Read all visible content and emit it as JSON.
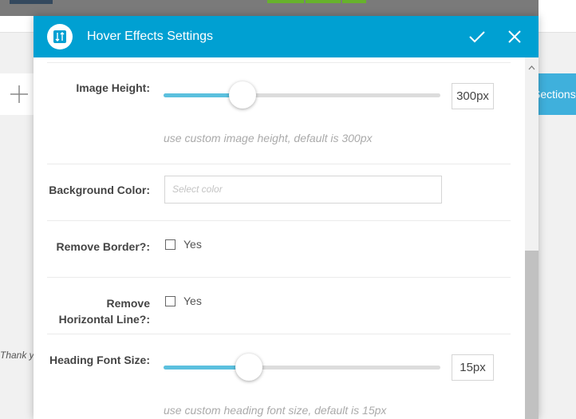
{
  "background": {
    "sections_label": "Sections",
    "thank_text": "Thank y"
  },
  "modal": {
    "title": "Hover Effects Settings"
  },
  "fields": {
    "image_height": {
      "label": "Image Height:",
      "value": "300px",
      "slider_fraction": 0.29,
      "hint": "use custom image height, default is 300px"
    },
    "background_color": {
      "label": "Background Color:",
      "placeholder": "Select color"
    },
    "remove_border": {
      "label": "Remove Border?:",
      "option": "Yes",
      "checked": false
    },
    "remove_horizontal_line": {
      "label_line1": "Remove",
      "label_line2": "Horizontal Line?:",
      "option": "Yes",
      "checked": false
    },
    "heading_font_size": {
      "label": "Heading Font Size:",
      "value": "15px",
      "slider_fraction": 0.31,
      "hint": "use custom heading font size, default is 15px"
    }
  },
  "colors": {
    "header_bg": "#00a0d2",
    "slider_fill": "#5bc0de",
    "sections_button": "#3fb0dc"
  },
  "icons": [
    "sort-icon",
    "check-icon",
    "close-icon",
    "plus-icon",
    "scroll-up-icon"
  ]
}
